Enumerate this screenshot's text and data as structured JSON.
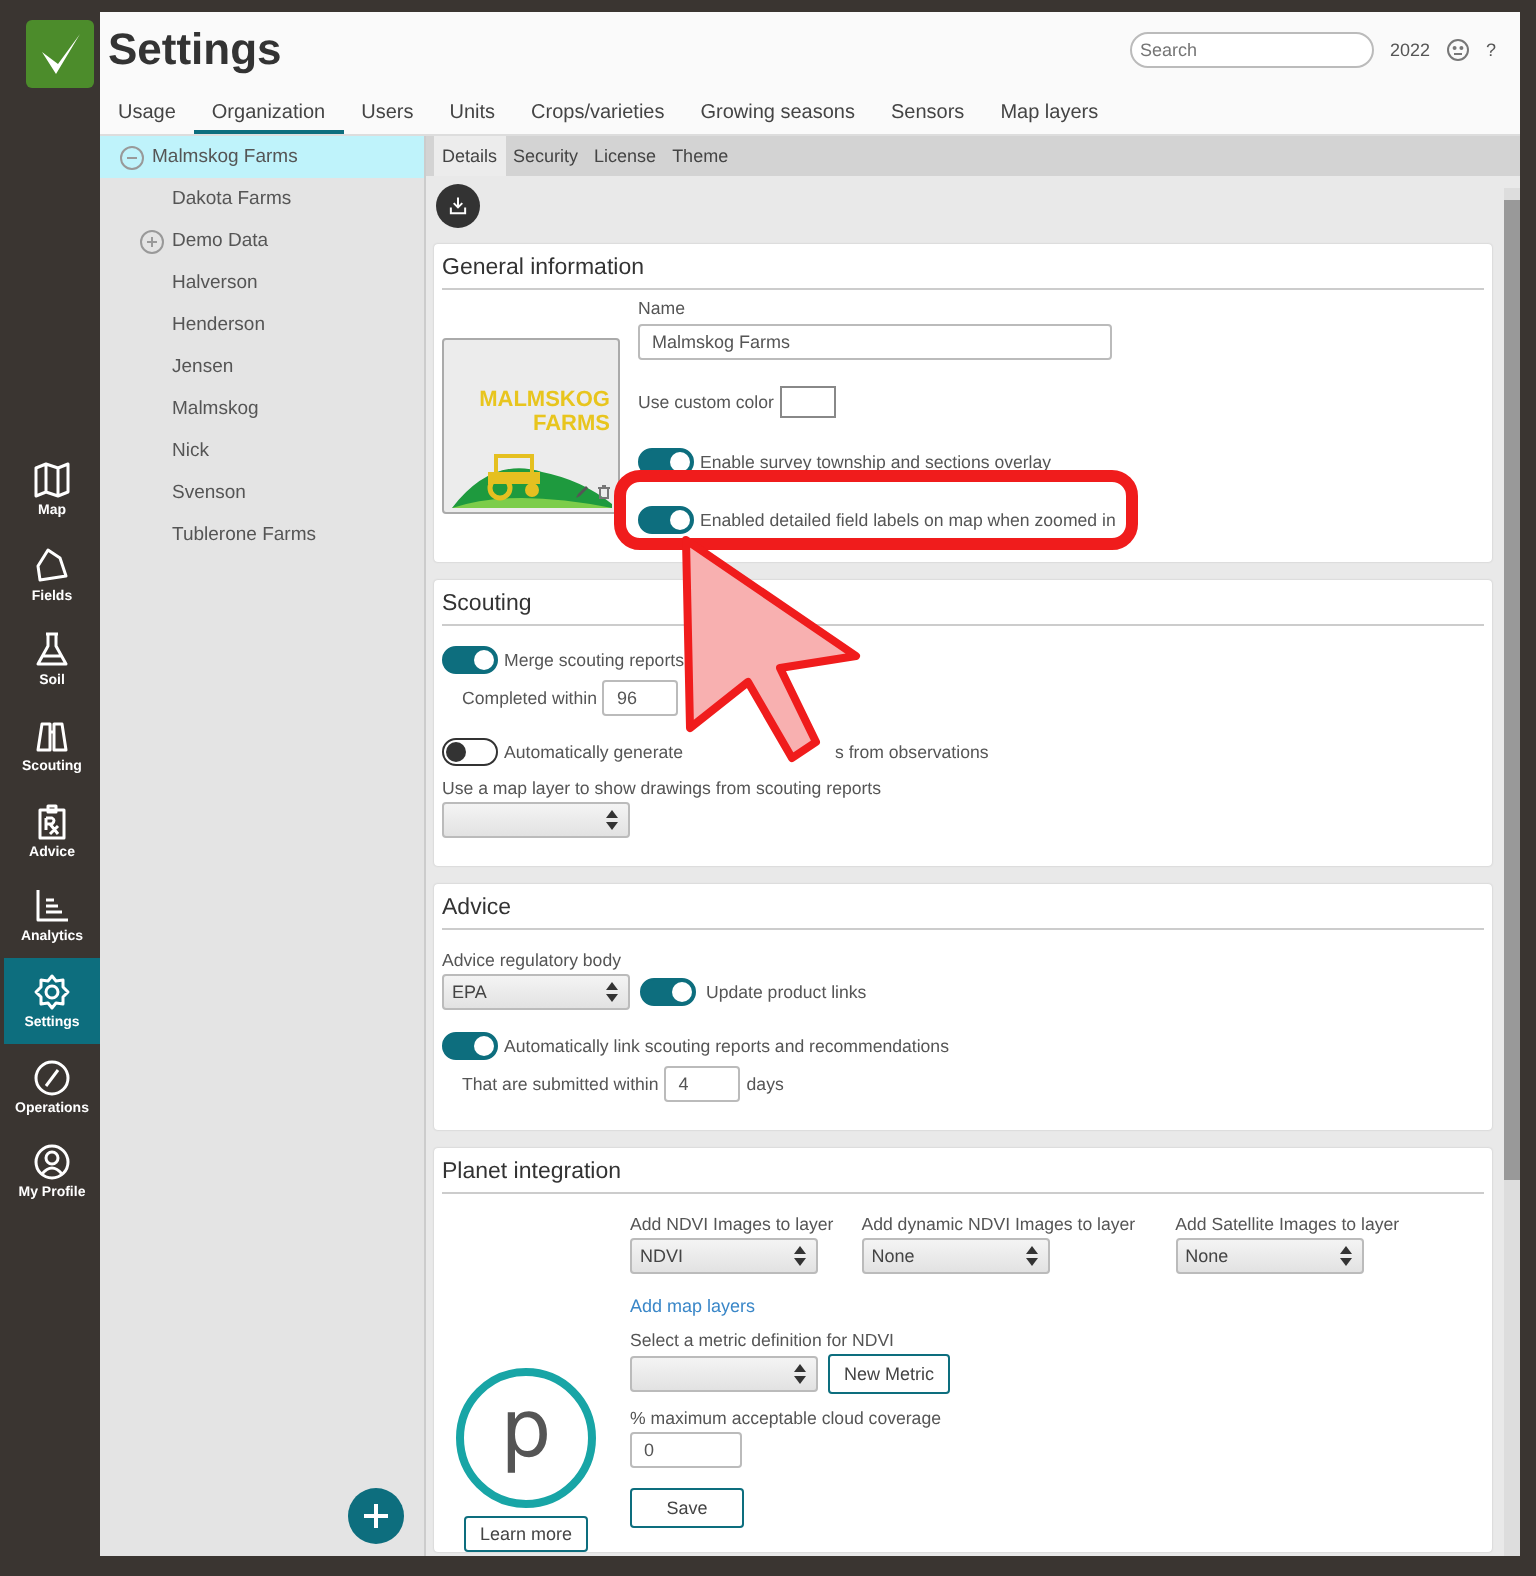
{
  "rail": {
    "items": [
      {
        "label": "Map",
        "kind": "map",
        "selected": false
      },
      {
        "label": "Fields",
        "kind": "fields",
        "selected": false
      },
      {
        "label": "Soil",
        "kind": "soil",
        "selected": false
      },
      {
        "label": "Scouting",
        "kind": "scouting",
        "selected": false
      },
      {
        "label": "Advice",
        "kind": "advice",
        "selected": false
      },
      {
        "label": "Analytics",
        "kind": "analytics",
        "selected": false
      },
      {
        "label": "Settings",
        "kind": "settings",
        "selected": true
      },
      {
        "label": "Operations",
        "kind": "operations",
        "selected": false
      },
      {
        "label": "My Profile",
        "kind": "profile",
        "selected": false
      }
    ]
  },
  "header": {
    "title": "Settings",
    "search": {
      "placeholder": "Search"
    },
    "year": "2022",
    "help": "?"
  },
  "tabs": [
    {
      "label": "Usage",
      "selected": false
    },
    {
      "label": "Organization",
      "selected": true
    },
    {
      "label": "Users",
      "selected": false
    },
    {
      "label": "Units",
      "selected": false
    },
    {
      "label": "Crops/varieties",
      "selected": false
    },
    {
      "label": "Growing seasons",
      "selected": false
    },
    {
      "label": "Sensors",
      "selected": false
    },
    {
      "label": "Map layers",
      "selected": false
    }
  ],
  "tree": [
    {
      "label": "Malmskog Farms",
      "selected": true,
      "expanded": true,
      "children": [
        {
          "label": "Dakota Farms",
          "selected": false
        },
        {
          "label": "Demo Data",
          "selected": false,
          "expanded": false
        },
        {
          "label": "Halverson",
          "selected": false
        },
        {
          "label": "Henderson",
          "selected": false
        },
        {
          "label": "Jensen",
          "selected": false
        },
        {
          "label": "Malmskog",
          "selected": false
        },
        {
          "label": "Nick",
          "selected": false
        },
        {
          "label": "Svenson",
          "selected": false
        },
        {
          "label": "Tublerone Farms",
          "selected": false
        }
      ]
    }
  ],
  "subtabs": [
    {
      "label": "Details",
      "selected": true
    },
    {
      "label": "Security",
      "selected": false
    },
    {
      "label": "License",
      "selected": false
    },
    {
      "label": "Theme",
      "selected": false
    }
  ],
  "general": {
    "title": "General information",
    "logo_text": "MALMSKOG FARMS",
    "name_label": "Name",
    "name_value": "Malmskog Farms",
    "custom_color_label": "Use custom color",
    "toggles": [
      {
        "label": "Enable survey township and sections overlay",
        "on": true
      },
      {
        "label": "Enabled detailed field labels on map when zoomed in",
        "on": true
      }
    ]
  },
  "scouting": {
    "title": "Scouting",
    "merge": {
      "label": "Merge scouting reports",
      "on": true
    },
    "completed_label": "Completed within",
    "completed_value": "96",
    "auto_generate": {
      "label_start": "Automatically generate",
      "label_end": "s from observations",
      "on": false
    },
    "map_layer_label": "Use a map layer to show drawings from scouting reports"
  },
  "advice": {
    "title": "Advice",
    "body_label": "Advice regulatory body",
    "body_value": "EPA",
    "update_links": {
      "label": "Update product links",
      "on": true
    },
    "auto_link": {
      "label": "Automatically link scouting reports and recommendations",
      "on": true
    },
    "submitted_label": "That are submitted within",
    "submitted_value": "4",
    "days": "days"
  },
  "planet": {
    "title": "Planet integration",
    "logo_letter": "p",
    "learn_more": "Learn more",
    "layers": [
      {
        "label": "Add NDVI Images to layer",
        "value": "NDVI"
      },
      {
        "label": "Add dynamic NDVI Images to layer",
        "value": "None"
      },
      {
        "label": "Add Satellite Images to layer",
        "value": "None"
      }
    ],
    "add_layers_link": "Add map layers",
    "metric_label": "Select a metric definition for NDVI",
    "new_metric": "New Metric",
    "cloud_label": "% maximum acceptable cloud coverage",
    "cloud_value": "0",
    "save": "Save"
  }
}
